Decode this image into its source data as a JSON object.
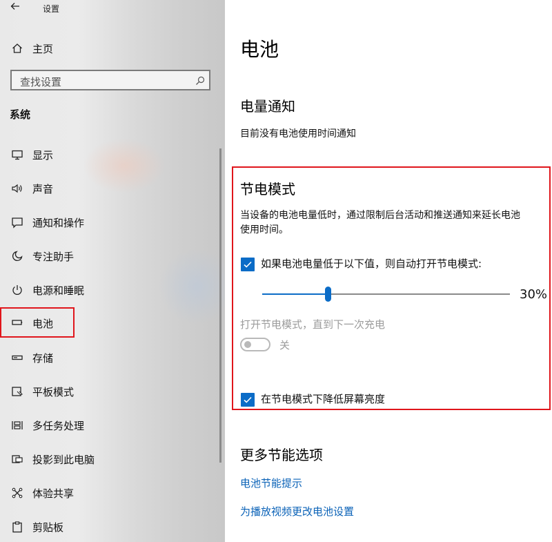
{
  "window": {
    "title": "设置",
    "back_icon": "back-arrow-icon"
  },
  "sidebar": {
    "home_label": "主页",
    "search_placeholder": "查找设置",
    "section_title": "系统",
    "items": [
      {
        "label": "显示",
        "icon": "display-icon"
      },
      {
        "label": "声音",
        "icon": "sound-icon"
      },
      {
        "label": "通知和操作",
        "icon": "notification-icon"
      },
      {
        "label": "专注助手",
        "icon": "moon-icon"
      },
      {
        "label": "电源和睡眠",
        "icon": "power-icon"
      },
      {
        "label": "电池",
        "icon": "battery-icon",
        "selected": true
      },
      {
        "label": "存储",
        "icon": "storage-icon"
      },
      {
        "label": "平板模式",
        "icon": "tablet-mode-icon"
      },
      {
        "label": "多任务处理",
        "icon": "multitask-icon"
      },
      {
        "label": "投影到此电脑",
        "icon": "project-icon"
      },
      {
        "label": "体验共享",
        "icon": "shared-experience-icon"
      },
      {
        "label": "剪贴板",
        "icon": "clipboard-icon"
      }
    ]
  },
  "main": {
    "title": "电池",
    "notification": {
      "heading": "电量通知",
      "text": "目前没有电池使用时间通知"
    },
    "saver": {
      "heading": "节电模式",
      "description_line1": "当设备的电池电量低时，通过限制后台活动和推送通知来延长电池",
      "description_line2": "使用时间。",
      "auto_checkbox_label": "如果电池电量低于以下值，则自动打开节电模式:",
      "auto_checked": true,
      "threshold_value": "30%",
      "threshold_percent": 30,
      "until_charge_label": "打开节电模式，直到下一次充电",
      "toggle_state_label": "关",
      "toggle_on": false,
      "brightness_checkbox_label": "在节电模式下降低屏幕亮度",
      "brightness_checked": true
    },
    "more": {
      "heading": "更多节能选项",
      "link1": "电池节能提示",
      "link2": "为播放视频更改电池设置"
    }
  },
  "colors": {
    "accent": "#0b6cc7",
    "highlight_border": "#e0151b",
    "link": "#0a62b7"
  }
}
